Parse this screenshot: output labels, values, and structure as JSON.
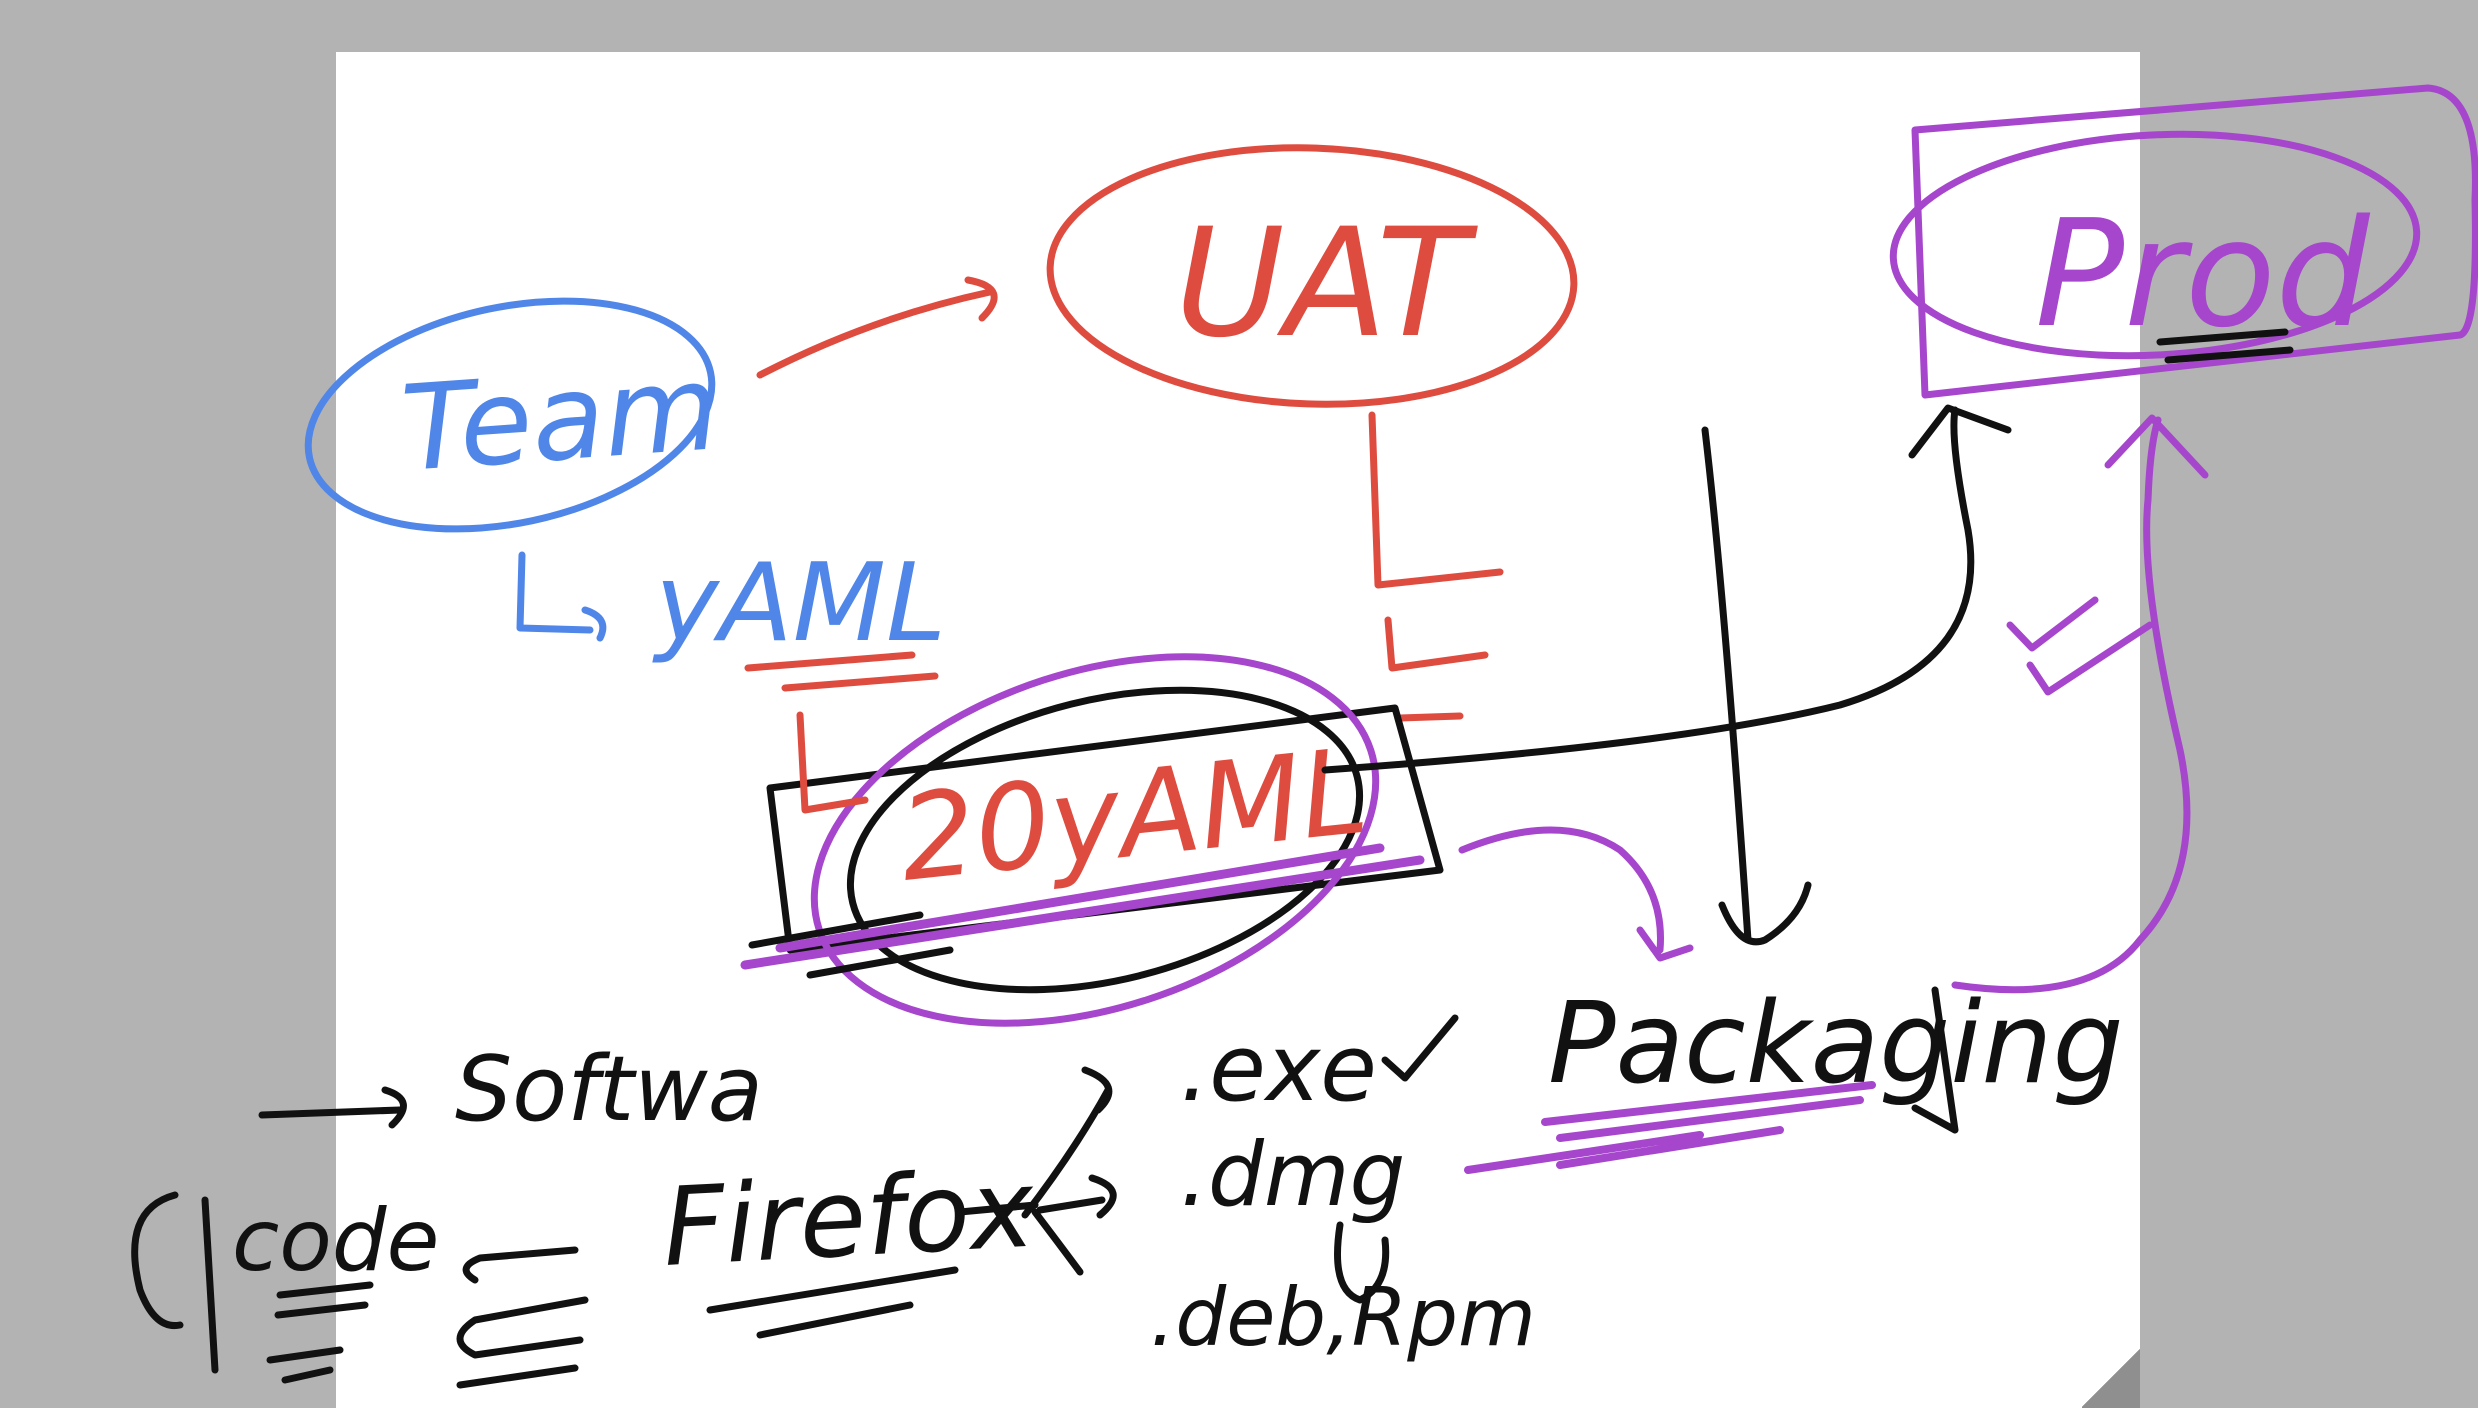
{
  "colors": {
    "background": "#b3b3b3",
    "page": "#ffffff",
    "blue_ink": "#4f86e8",
    "red_ink": "#de4c40",
    "purple_ink": "#a546cc",
    "black_ink": "#111111"
  },
  "nodes": {
    "team": "Team",
    "team_yaml": "yAML",
    "uat": "UAT",
    "yaml_box": "20yAML",
    "prod": "Prod",
    "packaging": "Packaging"
  },
  "notes": {
    "software": "Softwa",
    "code": "code",
    "firefox": "Firefox",
    "ext_exe": ".exe",
    "ext_dmg": ".dmg",
    "ext_deb_rpm": ".deb,Rpm"
  }
}
